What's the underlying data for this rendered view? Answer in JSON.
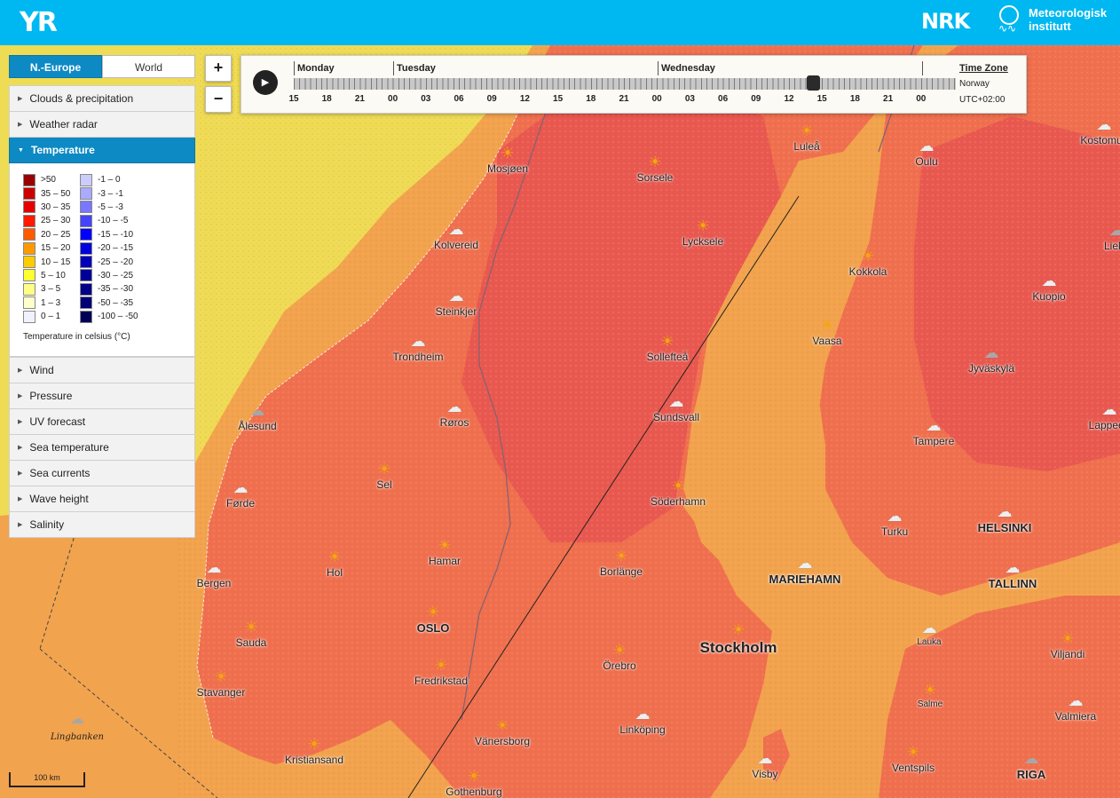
{
  "header": {
    "logo": "YR",
    "nrk_logo": "NRK",
    "partner_line1": "Meteorologisk",
    "partner_line2": "institutt"
  },
  "tabs": [
    {
      "label": "N.-Europe",
      "active": true
    },
    {
      "label": "World",
      "active": false
    }
  ],
  "zoom": {
    "in": "+",
    "out": "−"
  },
  "menu": {
    "top_items": [
      {
        "label": "Clouds & precipitation"
      },
      {
        "label": "Weather radar"
      },
      {
        "label": "Temperature",
        "active": true
      }
    ],
    "bottom_items": [
      {
        "label": "Wind"
      },
      {
        "label": "Pressure"
      },
      {
        "label": "UV forecast"
      },
      {
        "label": "Sea temperature"
      },
      {
        "label": "Sea currents"
      },
      {
        "label": "Wave height"
      },
      {
        "label": "Salinity"
      }
    ]
  },
  "legend": {
    "warm": [
      {
        "label": ">50",
        "color": "#990000"
      },
      {
        "label": "35 – 50",
        "color": "#cc0000"
      },
      {
        "label": "30 – 35",
        "color": "#e60000"
      },
      {
        "label": "25 – 30",
        "color": "#ff1a00"
      },
      {
        "label": "20 – 25",
        "color": "#ff5a00"
      },
      {
        "label": "15 – 20",
        "color": "#ff9900"
      },
      {
        "label": "10 – 15",
        "color": "#ffcc00"
      },
      {
        "label": "5 – 10",
        "color": "#ffff33"
      },
      {
        "label": "3 – 5",
        "color": "#ffff88"
      },
      {
        "label": "1 – 3",
        "color": "#ffffcc"
      },
      {
        "label": "0 – 1",
        "color": "#f2f2ff"
      }
    ],
    "cold": [
      {
        "label": "-1 – 0",
        "color": "#ccccff"
      },
      {
        "label": "-3 – -1",
        "color": "#aaaaff"
      },
      {
        "label": "-5 – -3",
        "color": "#7777ff"
      },
      {
        "label": "-10 – -5",
        "color": "#4444ff"
      },
      {
        "label": "-15 – -10",
        "color": "#0000ff"
      },
      {
        "label": "-20 – -15",
        "color": "#0000dd"
      },
      {
        "label": "-25 – -20",
        "color": "#0000bb"
      },
      {
        "label": "-30 – -25",
        "color": "#000099"
      },
      {
        "label": "-35 – -30",
        "color": "#000088"
      },
      {
        "label": "-50 – -35",
        "color": "#000077"
      },
      {
        "label": "-100 – -50",
        "color": "#000055"
      }
    ],
    "caption": "Temperature in celsius (°C)"
  },
  "timebar": {
    "days": [
      "Monday",
      "Tuesday",
      "Wednesday"
    ],
    "hours": [
      "15",
      "18",
      "21",
      "00",
      "03",
      "06",
      "09",
      "12",
      "15",
      "18",
      "21",
      "00",
      "03",
      "06",
      "09",
      "12",
      "15",
      "18",
      "21",
      "00"
    ],
    "timezone_title": "Time Zone",
    "timezone_name": "Norway",
    "timezone_offset": "UTC+02:00"
  },
  "scale": "100 km",
  "colors": {
    "header": "#00b8f1",
    "accent": "#0d8ac4",
    "map_sea": "#eedc55",
    "map_coastal": "#f2a34d",
    "map_land": "#ef6f4f",
    "map_inland": "#e85850"
  },
  "places": [
    {
      "name": "Mosjøen",
      "icon": "sun"
    },
    {
      "name": "Sorsele",
      "icon": "sun"
    },
    {
      "name": "Luleå",
      "icon": "sun"
    },
    {
      "name": "Oulu",
      "icon": "cloud"
    },
    {
      "name": "Kostomuk",
      "icon": "cloud"
    },
    {
      "name": "Kolvereid",
      "icon": "cloud"
    },
    {
      "name": "Lycksele",
      "icon": "sun"
    },
    {
      "name": "Kokkola",
      "icon": "sun"
    },
    {
      "name": "Lieks",
      "icon": "dark"
    },
    {
      "name": "Steinkjer",
      "icon": "cloud"
    },
    {
      "name": "Kuopio",
      "icon": "cloud"
    },
    {
      "name": "Vaasa",
      "icon": "sun"
    },
    {
      "name": "Trondheim",
      "icon": "cloud"
    },
    {
      "name": "Sollefteå",
      "icon": "sun"
    },
    {
      "name": "Jyväskylä",
      "icon": "dark"
    },
    {
      "name": "Ålesund",
      "icon": "dark"
    },
    {
      "name": "Røros",
      "icon": "cloud"
    },
    {
      "name": "Sundsvall",
      "icon": "cloud"
    },
    {
      "name": "Tampere",
      "icon": "cloud"
    },
    {
      "name": "Lappeen",
      "icon": "cloud"
    },
    {
      "name": "Sel",
      "icon": "sun"
    },
    {
      "name": "Førde",
      "icon": "cloud"
    },
    {
      "name": "Söderhamn",
      "icon": "sun"
    },
    {
      "name": "Turku",
      "icon": "cloud"
    },
    {
      "name": "HELSINKI",
      "icon": "cloud",
      "style": "cap"
    },
    {
      "name": "Hamar",
      "icon": "sun"
    },
    {
      "name": "Hol",
      "icon": "sun"
    },
    {
      "name": "Borlänge",
      "icon": "sun"
    },
    {
      "name": "MARIEHAMN",
      "icon": "cloud",
      "style": "cap"
    },
    {
      "name": "TALLINN",
      "icon": "cloud",
      "style": "cap"
    },
    {
      "name": "Bergen",
      "icon": "cloud"
    },
    {
      "name": "OSLO",
      "icon": "sun",
      "style": "cap"
    },
    {
      "name": "Stockholm",
      "icon": "sun",
      "style": "big"
    },
    {
      "name": "Lauka",
      "icon": "cloud",
      "style": "sm"
    },
    {
      "name": "Viljandi",
      "icon": "sun"
    },
    {
      "name": "Sauda",
      "icon": "sun"
    },
    {
      "name": "Örebro",
      "icon": "sun"
    },
    {
      "name": "Fredrikstad",
      "icon": "sun"
    },
    {
      "name": "Stavanger",
      "icon": "sun"
    },
    {
      "name": "Salme",
      "icon": "sun",
      "style": "sm"
    },
    {
      "name": "Valmiera",
      "icon": "cloud"
    },
    {
      "name": "Linköping",
      "icon": "cloud"
    },
    {
      "name": "Vänersborg",
      "icon": "sun"
    },
    {
      "name": "Kristiansand",
      "icon": "sun"
    },
    {
      "name": "Visby",
      "icon": "cloud"
    },
    {
      "name": "Ventspils",
      "icon": "sun"
    },
    {
      "name": "RIGA",
      "icon": "dark",
      "style": "cap"
    },
    {
      "name": "Gothenburg",
      "icon": "sun"
    },
    {
      "name": "Lingbanken",
      "icon": "dark",
      "style": "sea"
    }
  ]
}
